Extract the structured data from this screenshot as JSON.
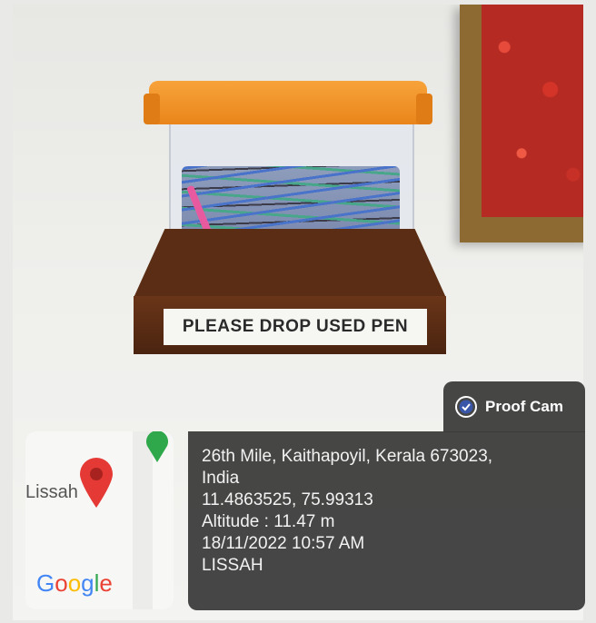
{
  "photo": {
    "sign_text": "PLEASE DROP USED PEN"
  },
  "map_tile": {
    "place_label": "Lissah",
    "logo_text": "Google",
    "logo_colors": [
      "#4285F4",
      "#EA4335",
      "#FBBC05",
      "#4285F4",
      "#34A853",
      "#EA4335"
    ],
    "pin_color": "#e53935",
    "secondary_pin_color": "#2ea84a"
  },
  "badge": {
    "icon": "check-circle-icon",
    "label": "Proof Cam"
  },
  "info": {
    "address_line1": "26th Mile, Kaithapoyil, Kerala 673023,",
    "address_line2": "India",
    "coordinates": "11.4863525, 75.99313",
    "altitude": "Altitude : 11.47 m",
    "datetime": "18/11/2022 10:57 AM",
    "place": "LISSAH"
  }
}
